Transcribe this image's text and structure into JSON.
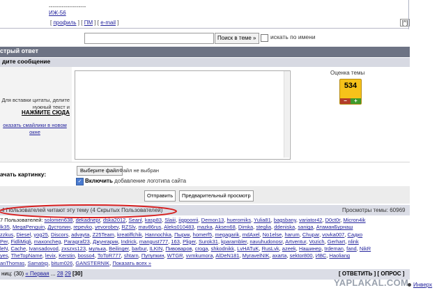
{
  "post": {
    "dash": "--------------------",
    "signature": "ИЖ-56",
    "links": {
      "profile": "профиль",
      "pm": "ПМ",
      "email": "e-mail"
    },
    "up": "[^]"
  },
  "search": {
    "button": "Поиск в теме »",
    "names_label": "искать по имени"
  },
  "quick_reply": {
    "title": "стрый ответ",
    "subtitle": "дите сообщение",
    "help_text_1": "Для вставки цитаты, делите нужный текст и",
    "help_text_2": "НАЖМИТЕ СЮДА",
    "help_text_3": "оказать смайлики в новом окне",
    "rating_label": "Оценка темы",
    "rating_value": "534",
    "rating_minus": "−",
    "rating_plus": "+",
    "attach_label": "ачать картинку:",
    "file_button": "Выберите файл",
    "file_status": "Файл не выбран",
    "logo_bold": "Включить",
    "logo_rest": " добавление логотипа сайта",
    "send": "Отправить",
    "preview": "Предварительный просмотр"
  },
  "online": {
    "readers": "4 Пользователей читают эту тему (4 Скрытых Пользователей)",
    "views": "Просмотры темы: 60969",
    "users_prefix": "7 Пользователей: ",
    "lines": [
      [
        "solomen638",
        "dekadnepr",
        "dska2012",
        "Seanl",
        "kasp83",
        "Slaiii",
        "iiggoorrii",
        "Demon13",
        "hueromiks",
        "Yulia81",
        "bagsbany",
        "variator42",
        "D0ct0r",
        "Micron4ik"
      ],
      [
        "lk35",
        "MegaPenguin",
        "Дустолин",
        "repevko",
        "yevorobev",
        "RZSlv",
        "mav86rus",
        "Aleks010483",
        "mazka",
        "Aksen68",
        "Dimka",
        "steglia",
        "ddeniska",
        "saniga",
        "АтаманБурнаш"
      ],
      [
        "zzkus",
        "Diesel",
        "yog25",
        "Discors",
        "advayta",
        "Z25Team",
        "kreatiffchik",
        "Hannochka",
        "Пырик",
        "homerf5",
        "megagarik",
        "mdAxel",
        "No1else",
        "harum",
        "Chupar",
        "vovka007",
        "Садко"
      ],
      [
        "Per",
        "FidliMigli",
        "maxoncheg",
        "Paragraf23",
        "Джунгарик",
        "Indrick",
        "mangust777",
        "163",
        "Pliger",
        "Surok31",
        "kparambler",
        "navuhudonosr",
        "Artventur",
        "Vozich",
        "Gerhart",
        "nlink"
      ],
      [
        "leN",
        "Cache",
        "Ivansadovod",
        "zxszxs123",
        "мулька",
        "Beilinger",
        "barbur",
        "ILKIN",
        "Пивоваров",
        "croga",
        "shkodnikk",
        "LvHATuK",
        "RusLvk",
        "azeek",
        "Нашинер",
        "trdeman",
        "fand",
        "NikR"
      ],
      [
        "yes",
        "TheTopName",
        "levix",
        "Kerstin",
        "bosso4",
        "ToToR777",
        "shtarn",
        "Пупупкин",
        "WTGR",
        "vvmkumora",
        "AlDeN181",
        "MyravelNIK",
        "axarta",
        "sektor800",
        "ИВС",
        "Haoliang"
      ],
      [
        "anThomas",
        "Samatxp",
        "bitum026",
        "GANSTERNIK",
        "Показать всех »"
      ]
    ]
  },
  "pages": {
    "prefix": "ниц: (30)",
    "first": "« Первая",
    "dots": " ... ",
    "p28": "28",
    "p29": "29",
    "current": "[30]",
    "actions": "[ ОТВЕТИТЬ ]  [ ОПРОС ]"
  },
  "watermark": "YAPLAKAL.COM",
  "invers": "Инверх"
}
